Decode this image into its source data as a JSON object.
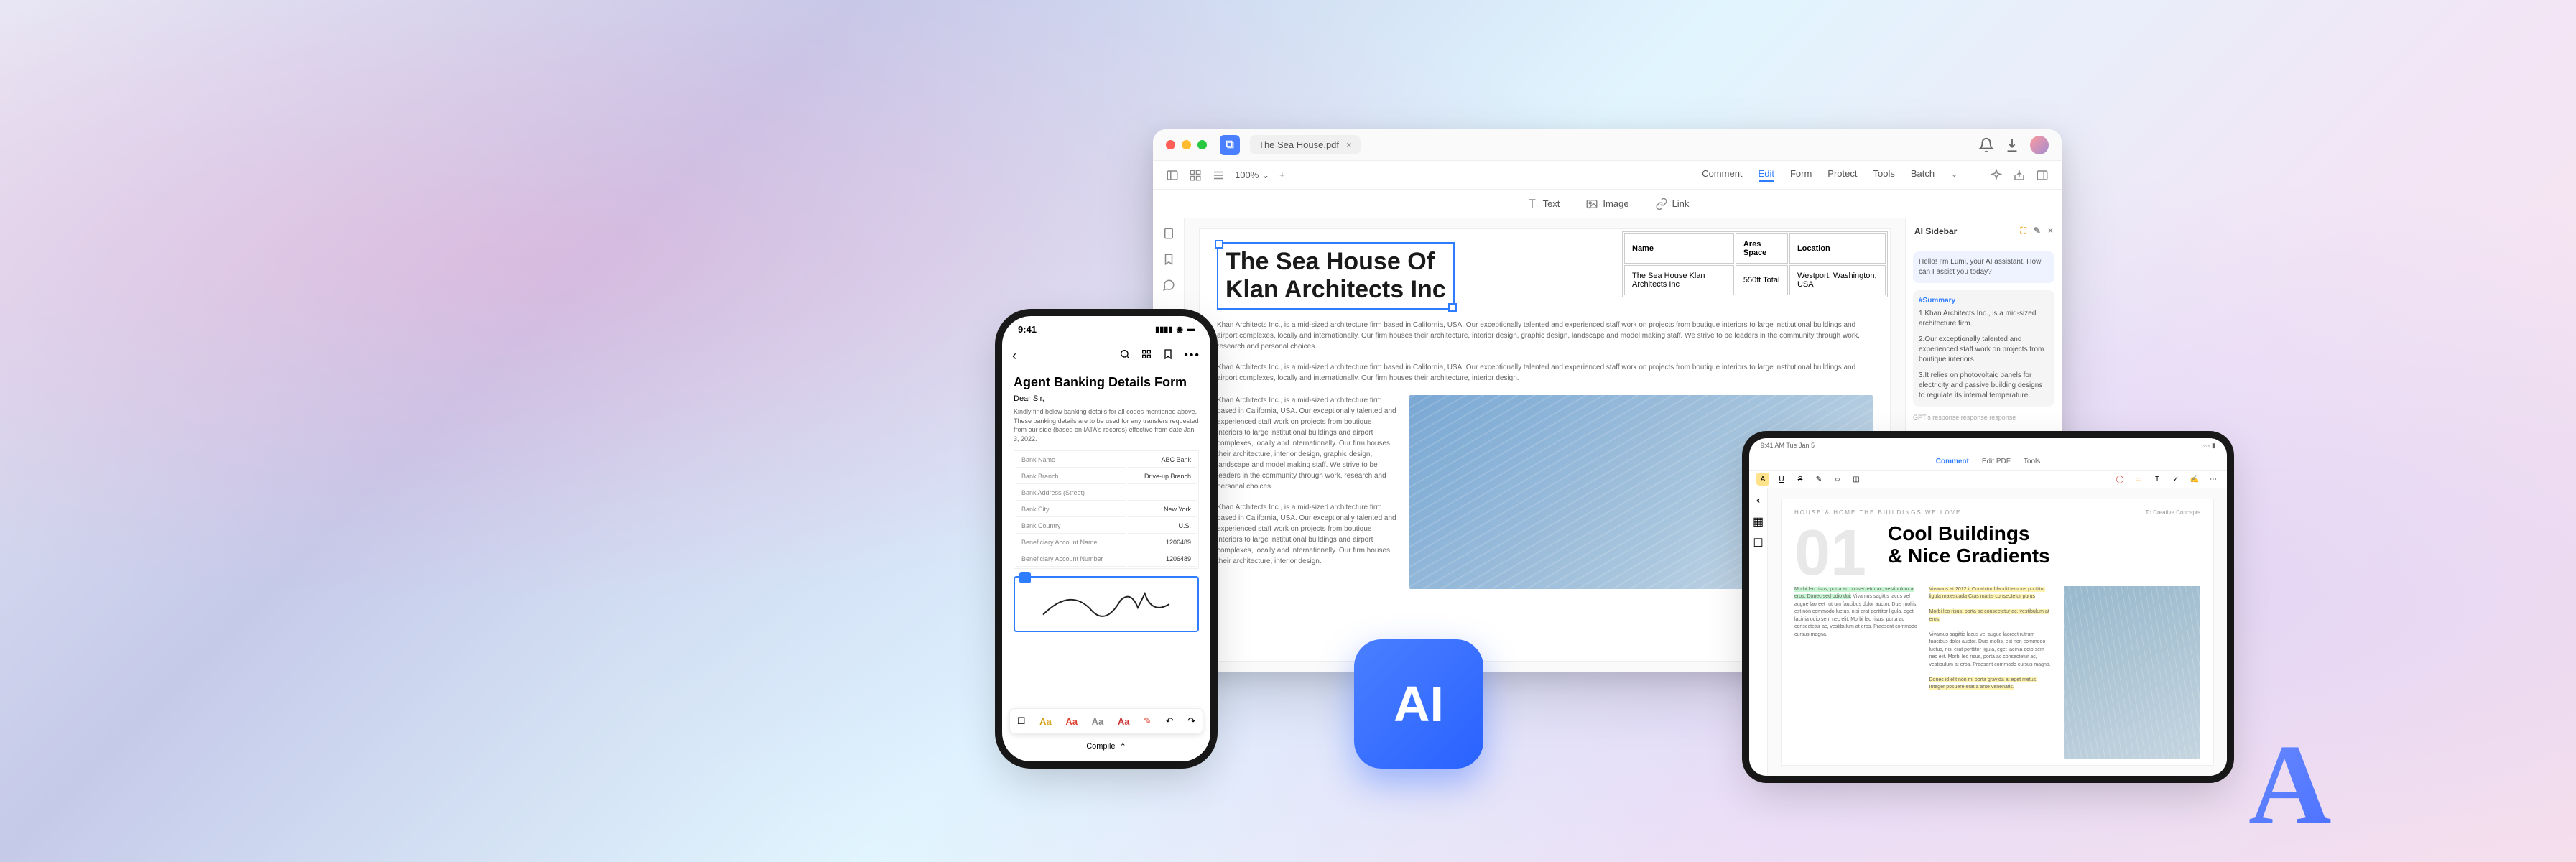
{
  "desktop": {
    "tab_title": "The Sea House.pdf",
    "zoom": "100%",
    "menu": [
      "Comment",
      "Edit",
      "Form",
      "Protect",
      "Tools",
      "Batch"
    ],
    "menu_active_index": 1,
    "sub_tools": {
      "text": "Text",
      "image": "Image",
      "link": "Link"
    },
    "doc_title": "The Sea House Of\nKlan Architects Inc",
    "para1": "Khan Architects Inc., is a mid-sized architecture firm based in California, USA. Our exceptionally talented and experienced staff work on projects from boutique interiors to large institutional buildings and airport complexes, locally and internationally. Our firm houses their architecture, interior design, graphic design, landscape and model making staff. We strive to be leaders in the community through work, research and personal choices.",
    "para2": "Khan Architects Inc., is a mid-sized architecture firm based in California, USA. Our exceptionally talented and experienced staff work on projects from boutique interiors to large institutional buildings and airport complexes, locally and internationally. Our firm houses their architecture, interior design.",
    "col_para1": "Khan Architects Inc., is a mid-sized architecture firm based in California, USA. Our exceptionally talented and experienced staff work on projects from boutique interiors to large institutional buildings and airport complexes, locally and internationally. Our firm houses their architecture, interior design, graphic design, landscape and model making staff. We strive to be leaders in the community through work, research and personal choices.",
    "col_para2": "Khan Architects Inc., is a mid-sized architecture firm based in California, USA. Our exceptionally talented and experienced staff work on projects from boutique interiors to large institutional buildings and airport complexes, locally and internationally. Our firm houses their architecture, interior design.",
    "table": {
      "headers": [
        "Name",
        "Ares Space",
        "Location"
      ],
      "row": [
        "The Sea House Klan Architects Inc",
        "550ft Total",
        "Westport, Washington, USA"
      ]
    },
    "ai": {
      "title": "AI Sidebar",
      "greeting": "Hello! I'm Lumi, your AI assistant. How can I assist you today?",
      "summary_tag": "#Summary",
      "point1": "1.Khan Architects Inc., is a mid-sized architecture firm.",
      "point2": "2.Our exceptionally talented and experienced staff work on projects from boutique interiors.",
      "point3": "3.It relies on photovoltaic panels for electricity and passive building designs to regulate its internal temperature.",
      "gpt_note": "GPT's response response response"
    }
  },
  "phone": {
    "time": "9:41",
    "title": "Agent Banking Details Form",
    "salutation": "Dear Sir,",
    "body": "Kindly find below banking details for all codes mentioned above. These banking details are to be used for any transfers requested from our side (based on IATA's records) effective from date Jan 3, 2022.",
    "rows": [
      [
        "Bank Name",
        "ABC Bank"
      ],
      [
        "Bank Branch",
        "Drive-up Branch"
      ],
      [
        "Bank Address (Street)",
        "-"
      ],
      [
        "Bank City",
        "New York"
      ],
      [
        "Bank Country",
        "U.S."
      ],
      [
        "Beneficiary Account Name",
        "1206489"
      ],
      [
        "Beneficiary Account Number",
        "1206489"
      ]
    ],
    "bottom_label": "Compile"
  },
  "ai_badge": "AI",
  "tablet": {
    "time": "9:41 AM Tue Jan 5",
    "tabs": [
      "Comment",
      "Edit PDF",
      "Tools"
    ],
    "tabs_active_index": 0,
    "smallcaps": "HOUSE & HOME   THE BUILDINGS WE LOVE",
    "right_label": "To Creative Concepts",
    "bignum": "01",
    "headline": "Cool Buildings\n& Nice Gradients",
    "col_text": "Vivamus sagittis lacus vel augue laoreet rutrum faucibus dolor auctor. Duis mollis, est non commodo luctus, nisi erat porttitor ligula, eget lacinia odio sem nec elit. Morbi leo risus, porta ac consectetur ac, vestibulum at eros. Praesent commodo cursus magna.",
    "hl_green": "Morbi leo risus, porta ac consectetur ac, vestibulum at eros. Donec sed odio dui.",
    "hl_yellow1": "Vivamus at 2012 i, Curabitur blandit tempus porttitor ligula malesuada Cras mattis consectetur purus",
    "hl_yellow2": "Morbi leo risus, porta ac consectetur ac, vestibulum at eros.",
    "hl_yellow3": "Donec id elit non mi porta gravida at eget metus. Integer posuere erat a ante venenatis."
  }
}
